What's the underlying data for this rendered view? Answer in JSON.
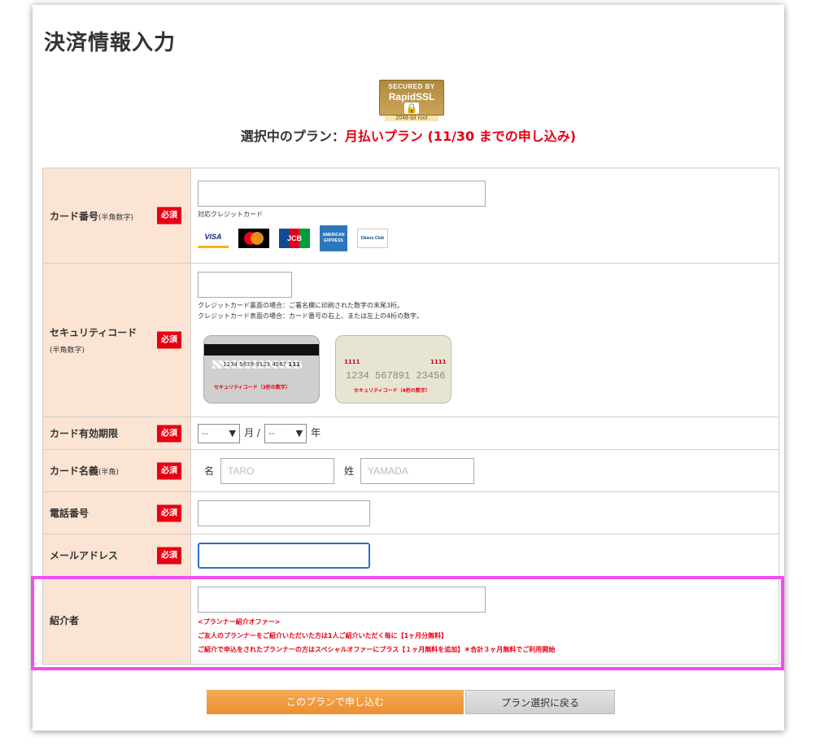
{
  "page": {
    "title": "決済情報入力"
  },
  "ssl_badge": {
    "line1": "SECURED BY",
    "line2": "RapidSSL",
    "line3": "2048-bit root"
  },
  "plan": {
    "prefix": "選択中のプラン：",
    "name": "月払いプラン (11/30 までの申し込み)"
  },
  "form": {
    "required_label": "必須",
    "card_number": {
      "label": "カード番号",
      "label_small": "(半角数字)",
      "supported_text": "対応クレジットカード",
      "cards": [
        "VISA",
        "mastercard",
        "JCB",
        "AMERICAN EXPRESS",
        "Diners Club"
      ]
    },
    "security_code": {
      "label": "セキュリティコード",
      "label_small": "(半角数字)",
      "note1": "クレジットカード裏面の場合：ご署名欄に印刷された数字の末尾3桁。",
      "note2": "クレジットカード表面の場合：カード番号の右上、または左上の4桁の数字。",
      "back_sample": "1234 5678 9123 4567",
      "back_digits": "111",
      "back_label": "セキュリティコード（3桁の数字）",
      "front_digits_left": "1111",
      "front_digits_right": "1111",
      "front_sample": "1234 567891 23456",
      "front_label": "セキュリティコード（4桁の数字）"
    },
    "expiry": {
      "label": "カード有効期限",
      "month_value": "--",
      "month_unit": "月 /",
      "year_value": "--",
      "year_unit": "年"
    },
    "card_name": {
      "label": "カード名義",
      "label_small": "(半角)",
      "first_label": "名",
      "first_placeholder": "TARO",
      "last_label": "姓",
      "last_placeholder": "YAMADA"
    },
    "phone": {
      "label": "電話番号"
    },
    "email": {
      "label": "メールアドレス"
    },
    "referrer": {
      "label": "紹介者",
      "offer_title": "<プランナー紹介オファー>",
      "offer_line1": "ご友人のプランナーをご紹介いただいた方は1人ご紹介いただく毎に【1ヶ月分無料】",
      "offer_line2": "ご紹介で申込をされたプランナーの方はスペシャルオファーにプラス【１ヶ月無料を追加】＊合計３ヶ月無料でご利用開始"
    }
  },
  "buttons": {
    "apply": "このプランで申し込む",
    "back": "プラン選択に戻る"
  },
  "colors": {
    "required": "#e60012",
    "label_bg": "#fbe4d3",
    "highlight": "#f24df2",
    "apply_button": "#f0a04a",
    "focus_border": "#2a6fc9"
  }
}
